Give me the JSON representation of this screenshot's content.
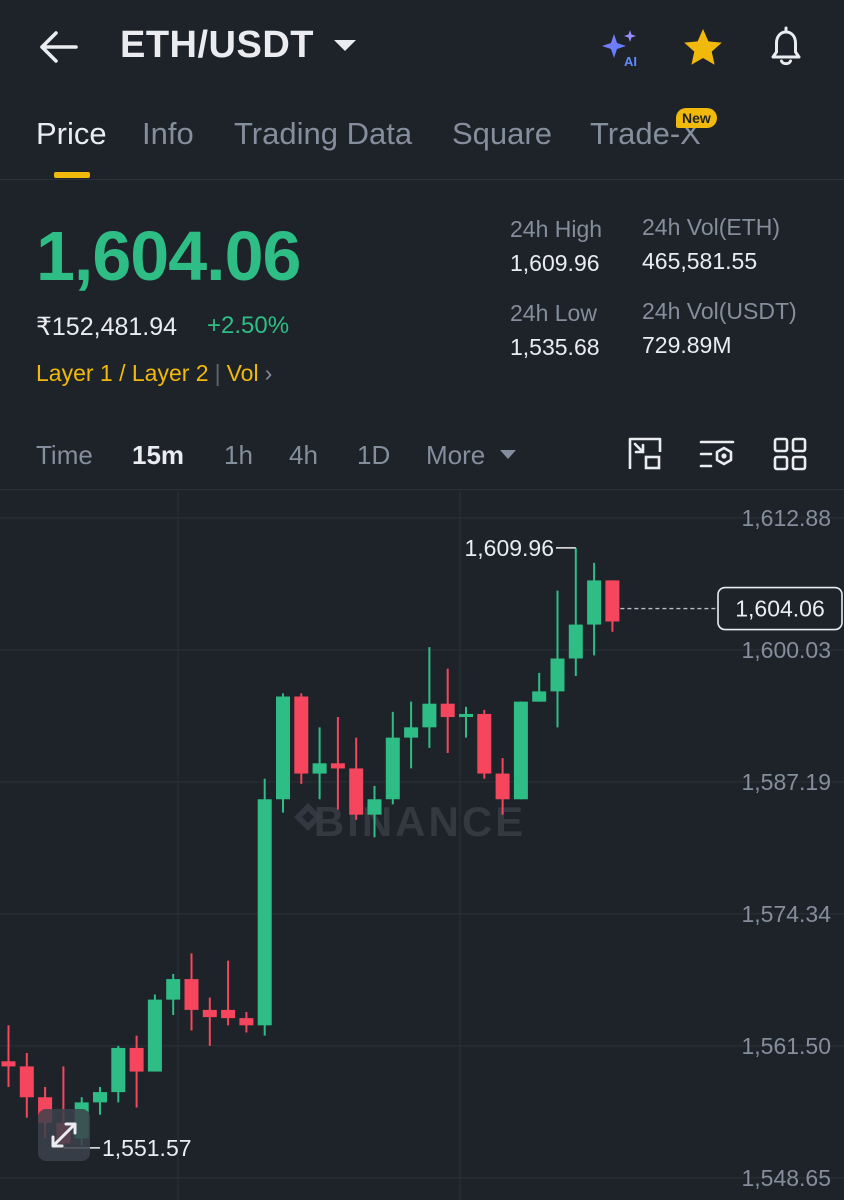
{
  "header": {
    "pair": "ETH/USDT",
    "icons": [
      "back-arrow-icon",
      "ai-sparkle-icon",
      "star-icon",
      "bell-icon"
    ]
  },
  "tabs": [
    {
      "label": "Price",
      "active": true
    },
    {
      "label": "Info"
    },
    {
      "label": "Trading Data"
    },
    {
      "label": "Square"
    },
    {
      "label": "Trade-X",
      "badge": "New"
    }
  ],
  "ticker": {
    "price": "1,604.06",
    "inr_price": "₹152,481.94",
    "change": "+2.50%",
    "tag1": "Layer 1 / Layer 2",
    "tag2": "Vol",
    "high_label": "24h High",
    "high_value": "1,609.96",
    "low_label": "24h Low",
    "low_value": "1,535.68",
    "vol_eth_label": "24h Vol(ETH)",
    "vol_eth_value": "465,581.55",
    "vol_usdt_label": "24h Vol(USDT)",
    "vol_usdt_value": "729.89M"
  },
  "timeframes": {
    "time": "Time",
    "m15": "15m",
    "h1": "1h",
    "h4": "4h",
    "d1": "1D",
    "more": "More",
    "active": "15m"
  },
  "colors": {
    "background": "#1e2329",
    "up": "#2ebd85",
    "down": "#f6465d",
    "accent": "#f0b90b",
    "muted": "#848e9c"
  },
  "chart_data": {
    "type": "candlestick",
    "interval": "15m",
    "y_ticks": [
      "1,612.88",
      "1,600.03",
      "1,587.19",
      "1,574.34",
      "1,561.50",
      "1,548.65"
    ],
    "ylim": [
      1546.5,
      1615.5
    ],
    "grid": true,
    "watermark": "BINANCE",
    "current_price": "1,604.06",
    "high_annotation": "1,609.96",
    "low_annotation": "1,551.57",
    "candles": [
      {
        "o": 1560.0,
        "h": 1563.5,
        "c": 1559.5,
        "l": 1557.5
      },
      {
        "o": 1559.5,
        "h": 1560.8,
        "c": 1556.5,
        "l": 1554.5
      },
      {
        "o": 1556.5,
        "h": 1557.5,
        "c": 1554.0,
        "l": 1552.5
      },
      {
        "o": 1554.0,
        "h": 1559.5,
        "c": 1552.0,
        "l": 1551.57
      },
      {
        "o": 1552.5,
        "h": 1556.5,
        "c": 1556.0,
        "l": 1551.8
      },
      {
        "o": 1556.0,
        "h": 1557.5,
        "c": 1557.0,
        "l": 1554.8
      },
      {
        "o": 1557.0,
        "h": 1561.5,
        "c": 1561.3,
        "l": 1556.0
      },
      {
        "o": 1561.3,
        "h": 1562.5,
        "c": 1559.0,
        "l": 1555.5
      },
      {
        "o": 1559.0,
        "h": 1566.5,
        "c": 1566.0,
        "l": 1559.0
      },
      {
        "o": 1566.0,
        "h": 1568.5,
        "c": 1568.0,
        "l": 1564.5
      },
      {
        "o": 1568.0,
        "h": 1570.5,
        "c": 1565.0,
        "l": 1563.0
      },
      {
        "o": 1565.0,
        "h": 1566.2,
        "c": 1564.3,
        "l": 1561.5
      },
      {
        "o": 1565.0,
        "h": 1569.8,
        "c": 1564.2,
        "l": 1563.5
      },
      {
        "o": 1564.2,
        "h": 1564.8,
        "c": 1563.5,
        "l": 1562.8
      },
      {
        "o": 1563.5,
        "h": 1587.5,
        "c": 1585.5,
        "l": 1562.5
      },
      {
        "o": 1585.5,
        "h": 1595.8,
        "c": 1595.5,
        "l": 1584.2
      },
      {
        "o": 1595.5,
        "h": 1595.8,
        "c": 1588.0,
        "l": 1587.0
      },
      {
        "o": 1588.0,
        "h": 1592.5,
        "c": 1589.0,
        "l": 1585.5
      },
      {
        "o": 1589.0,
        "h": 1593.5,
        "c": 1588.5,
        "l": 1584.5
      },
      {
        "o": 1588.5,
        "h": 1591.5,
        "c": 1584.0,
        "l": 1583.5
      },
      {
        "o": 1584.0,
        "h": 1586.8,
        "c": 1585.5,
        "l": 1581.8
      },
      {
        "o": 1585.5,
        "h": 1594.0,
        "c": 1591.5,
        "l": 1585.0
      },
      {
        "o": 1591.5,
        "h": 1595.0,
        "c": 1592.5,
        "l": 1588.5
      },
      {
        "o": 1592.5,
        "h": 1600.3,
        "c": 1594.8,
        "l": 1590.5
      },
      {
        "o": 1594.8,
        "h": 1598.2,
        "c": 1593.5,
        "l": 1590.0
      },
      {
        "o": 1593.5,
        "h": 1594.5,
        "c": 1593.8,
        "l": 1591.5
      },
      {
        "o": 1593.8,
        "h": 1594.2,
        "c": 1588.0,
        "l": 1587.5
      },
      {
        "o": 1588.0,
        "h": 1589.5,
        "c": 1585.5,
        "l": 1584.0
      },
      {
        "o": 1585.5,
        "h": 1595.0,
        "c": 1595.0,
        "l": 1585.5
      },
      {
        "o": 1595.0,
        "h": 1597.8,
        "c": 1596.0,
        "l": 1595.0
      },
      {
        "o": 1596.0,
        "h": 1605.8,
        "c": 1599.2,
        "l": 1592.5
      },
      {
        "o": 1599.2,
        "h": 1609.96,
        "c": 1602.5,
        "l": 1597.5
      },
      {
        "o": 1602.5,
        "h": 1608.5,
        "c": 1606.8,
        "l": 1599.5
      },
      {
        "o": 1606.8,
        "h": 1606.8,
        "c": 1602.8,
        "l": 1601.8
      }
    ]
  }
}
